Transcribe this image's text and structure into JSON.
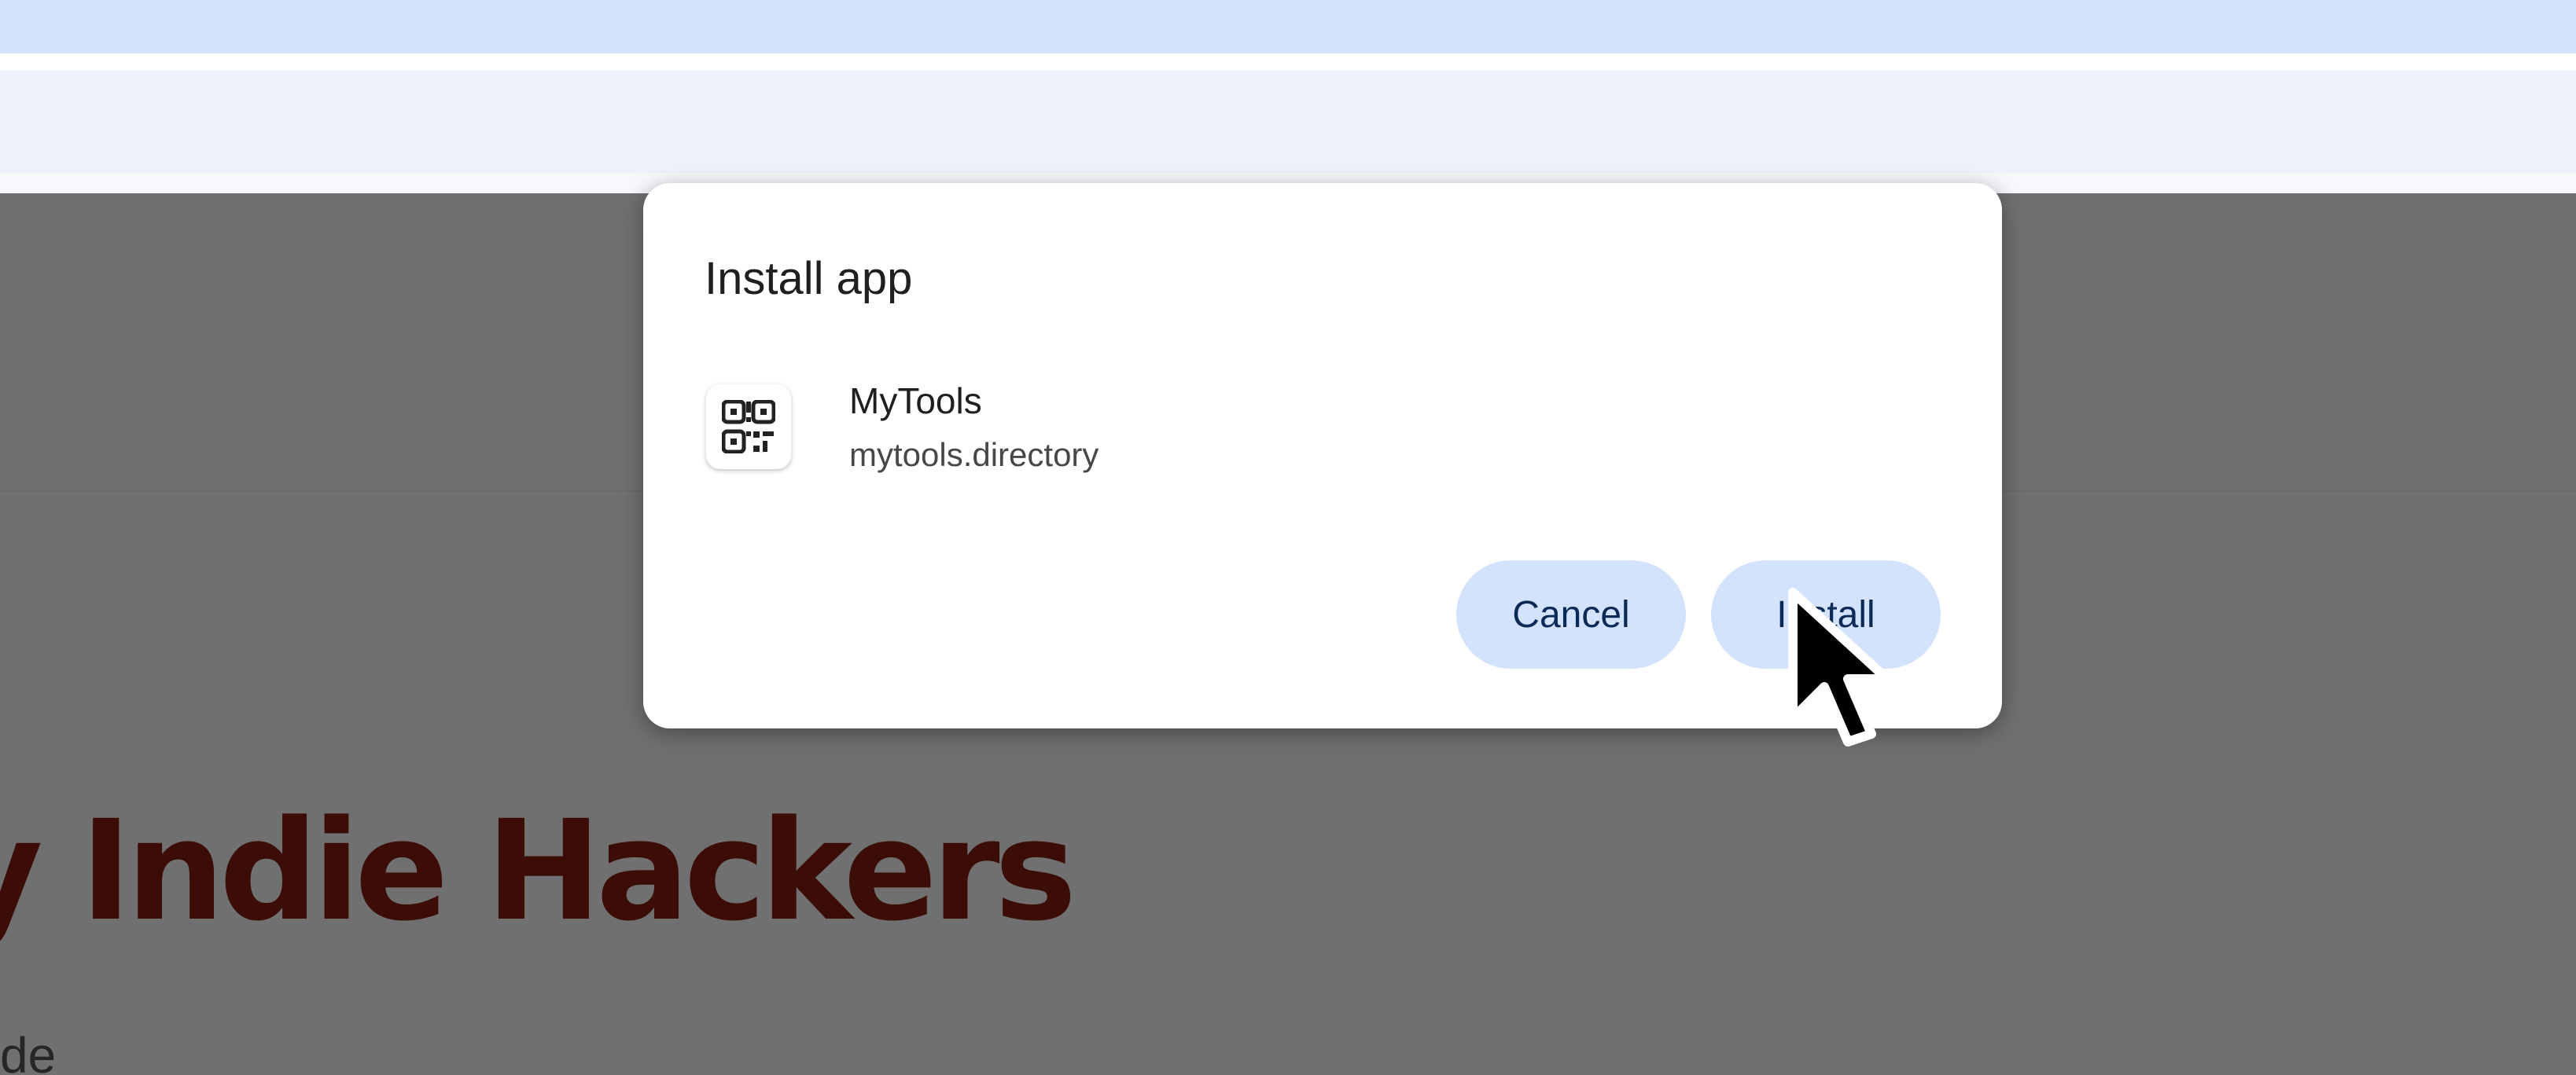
{
  "background_page": {
    "hero_title": "y Indie Hackers",
    "hero_subtitle": "de"
  },
  "dialog": {
    "title": "Install app",
    "app": {
      "icon": "qr-code-icon",
      "name": "MyTools",
      "origin": "mytools.directory"
    },
    "buttons": {
      "cancel_label": "Cancel",
      "install_label": "Install"
    }
  },
  "colors": {
    "tabstrip": "#d3e3fd",
    "button_bg": "#d3e3fd",
    "button_text": "#0b2a55",
    "scrim": "#707070",
    "hero_title": "#3c0d07"
  }
}
